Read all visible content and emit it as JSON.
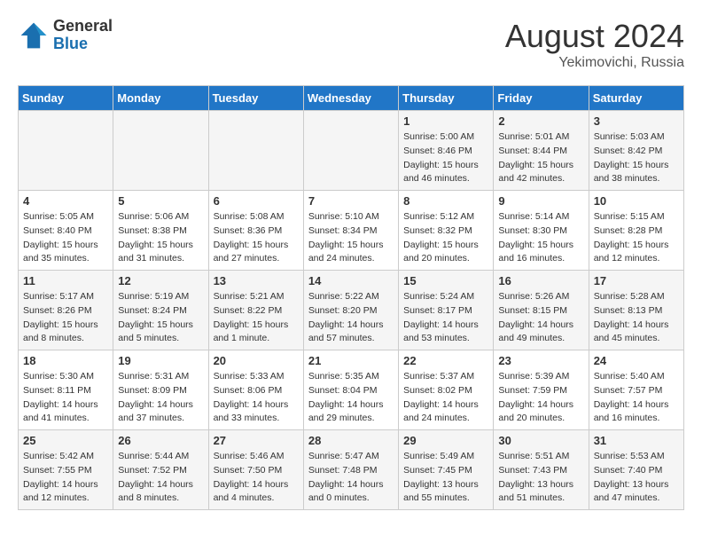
{
  "header": {
    "logo_general": "General",
    "logo_blue": "Blue",
    "month_year": "August 2024",
    "location": "Yekimovichi, Russia"
  },
  "days_of_week": [
    "Sunday",
    "Monday",
    "Tuesday",
    "Wednesday",
    "Thursday",
    "Friday",
    "Saturday"
  ],
  "weeks": [
    [
      {
        "day": "",
        "detail": ""
      },
      {
        "day": "",
        "detail": ""
      },
      {
        "day": "",
        "detail": ""
      },
      {
        "day": "",
        "detail": ""
      },
      {
        "day": "1",
        "sunrise": "Sunrise: 5:00 AM",
        "sunset": "Sunset: 8:46 PM",
        "daylight": "Daylight: 15 hours and 46 minutes."
      },
      {
        "day": "2",
        "sunrise": "Sunrise: 5:01 AM",
        "sunset": "Sunset: 8:44 PM",
        "daylight": "Daylight: 15 hours and 42 minutes."
      },
      {
        "day": "3",
        "sunrise": "Sunrise: 5:03 AM",
        "sunset": "Sunset: 8:42 PM",
        "daylight": "Daylight: 15 hours and 38 minutes."
      }
    ],
    [
      {
        "day": "4",
        "sunrise": "Sunrise: 5:05 AM",
        "sunset": "Sunset: 8:40 PM",
        "daylight": "Daylight: 15 hours and 35 minutes."
      },
      {
        "day": "5",
        "sunrise": "Sunrise: 5:06 AM",
        "sunset": "Sunset: 8:38 PM",
        "daylight": "Daylight: 15 hours and 31 minutes."
      },
      {
        "day": "6",
        "sunrise": "Sunrise: 5:08 AM",
        "sunset": "Sunset: 8:36 PM",
        "daylight": "Daylight: 15 hours and 27 minutes."
      },
      {
        "day": "7",
        "sunrise": "Sunrise: 5:10 AM",
        "sunset": "Sunset: 8:34 PM",
        "daylight": "Daylight: 15 hours and 24 minutes."
      },
      {
        "day": "8",
        "sunrise": "Sunrise: 5:12 AM",
        "sunset": "Sunset: 8:32 PM",
        "daylight": "Daylight: 15 hours and 20 minutes."
      },
      {
        "day": "9",
        "sunrise": "Sunrise: 5:14 AM",
        "sunset": "Sunset: 8:30 PM",
        "daylight": "Daylight: 15 hours and 16 minutes."
      },
      {
        "day": "10",
        "sunrise": "Sunrise: 5:15 AM",
        "sunset": "Sunset: 8:28 PM",
        "daylight": "Daylight: 15 hours and 12 minutes."
      }
    ],
    [
      {
        "day": "11",
        "sunrise": "Sunrise: 5:17 AM",
        "sunset": "Sunset: 8:26 PM",
        "daylight": "Daylight: 15 hours and 8 minutes."
      },
      {
        "day": "12",
        "sunrise": "Sunrise: 5:19 AM",
        "sunset": "Sunset: 8:24 PM",
        "daylight": "Daylight: 15 hours and 5 minutes."
      },
      {
        "day": "13",
        "sunrise": "Sunrise: 5:21 AM",
        "sunset": "Sunset: 8:22 PM",
        "daylight": "Daylight: 15 hours and 1 minute."
      },
      {
        "day": "14",
        "sunrise": "Sunrise: 5:22 AM",
        "sunset": "Sunset: 8:20 PM",
        "daylight": "Daylight: 14 hours and 57 minutes."
      },
      {
        "day": "15",
        "sunrise": "Sunrise: 5:24 AM",
        "sunset": "Sunset: 8:17 PM",
        "daylight": "Daylight: 14 hours and 53 minutes."
      },
      {
        "day": "16",
        "sunrise": "Sunrise: 5:26 AM",
        "sunset": "Sunset: 8:15 PM",
        "daylight": "Daylight: 14 hours and 49 minutes."
      },
      {
        "day": "17",
        "sunrise": "Sunrise: 5:28 AM",
        "sunset": "Sunset: 8:13 PM",
        "daylight": "Daylight: 14 hours and 45 minutes."
      }
    ],
    [
      {
        "day": "18",
        "sunrise": "Sunrise: 5:30 AM",
        "sunset": "Sunset: 8:11 PM",
        "daylight": "Daylight: 14 hours and 41 minutes."
      },
      {
        "day": "19",
        "sunrise": "Sunrise: 5:31 AM",
        "sunset": "Sunset: 8:09 PM",
        "daylight": "Daylight: 14 hours and 37 minutes."
      },
      {
        "day": "20",
        "sunrise": "Sunrise: 5:33 AM",
        "sunset": "Sunset: 8:06 PM",
        "daylight": "Daylight: 14 hours and 33 minutes."
      },
      {
        "day": "21",
        "sunrise": "Sunrise: 5:35 AM",
        "sunset": "Sunset: 8:04 PM",
        "daylight": "Daylight: 14 hours and 29 minutes."
      },
      {
        "day": "22",
        "sunrise": "Sunrise: 5:37 AM",
        "sunset": "Sunset: 8:02 PM",
        "daylight": "Daylight: 14 hours and 24 minutes."
      },
      {
        "day": "23",
        "sunrise": "Sunrise: 5:39 AM",
        "sunset": "Sunset: 7:59 PM",
        "daylight": "Daylight: 14 hours and 20 minutes."
      },
      {
        "day": "24",
        "sunrise": "Sunrise: 5:40 AM",
        "sunset": "Sunset: 7:57 PM",
        "daylight": "Daylight: 14 hours and 16 minutes."
      }
    ],
    [
      {
        "day": "25",
        "sunrise": "Sunrise: 5:42 AM",
        "sunset": "Sunset: 7:55 PM",
        "daylight": "Daylight: 14 hours and 12 minutes."
      },
      {
        "day": "26",
        "sunrise": "Sunrise: 5:44 AM",
        "sunset": "Sunset: 7:52 PM",
        "daylight": "Daylight: 14 hours and 8 minutes."
      },
      {
        "day": "27",
        "sunrise": "Sunrise: 5:46 AM",
        "sunset": "Sunset: 7:50 PM",
        "daylight": "Daylight: 14 hours and 4 minutes."
      },
      {
        "day": "28",
        "sunrise": "Sunrise: 5:47 AM",
        "sunset": "Sunset: 7:48 PM",
        "daylight": "Daylight: 14 hours and 0 minutes."
      },
      {
        "day": "29",
        "sunrise": "Sunrise: 5:49 AM",
        "sunset": "Sunset: 7:45 PM",
        "daylight": "Daylight: 13 hours and 55 minutes."
      },
      {
        "day": "30",
        "sunrise": "Sunrise: 5:51 AM",
        "sunset": "Sunset: 7:43 PM",
        "daylight": "Daylight: 13 hours and 51 minutes."
      },
      {
        "day": "31",
        "sunrise": "Sunrise: 5:53 AM",
        "sunset": "Sunset: 7:40 PM",
        "daylight": "Daylight: 13 hours and 47 minutes."
      }
    ]
  ]
}
